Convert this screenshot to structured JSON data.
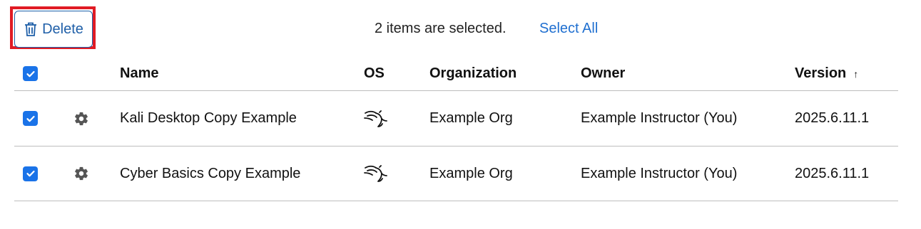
{
  "toolbar": {
    "delete_label": "Delete",
    "selection_text": "2 items are selected.",
    "select_all_label": "Select All"
  },
  "colors": {
    "accent": "#1a73e8",
    "link": "#1f6fd0",
    "highlight_border": "#e01b24"
  },
  "table": {
    "headers": {
      "name": "Name",
      "os": "OS",
      "organization": "Organization",
      "owner": "Owner",
      "version": "Version"
    },
    "sort": {
      "column": "version",
      "direction": "ascending",
      "indicator": "↑"
    },
    "rows": [
      {
        "selected": true,
        "name": "Kali Desktop Copy Example",
        "os_icon": "kali-dragon-icon",
        "organization": "Example Org",
        "owner": "Example Instructor (You)",
        "version": "2025.6.11.1"
      },
      {
        "selected": true,
        "name": "Cyber Basics Copy Example",
        "os_icon": "kali-dragon-icon",
        "organization": "Example Org",
        "owner": "Example Instructor (You)",
        "version": "2025.6.11.1"
      }
    ]
  }
}
